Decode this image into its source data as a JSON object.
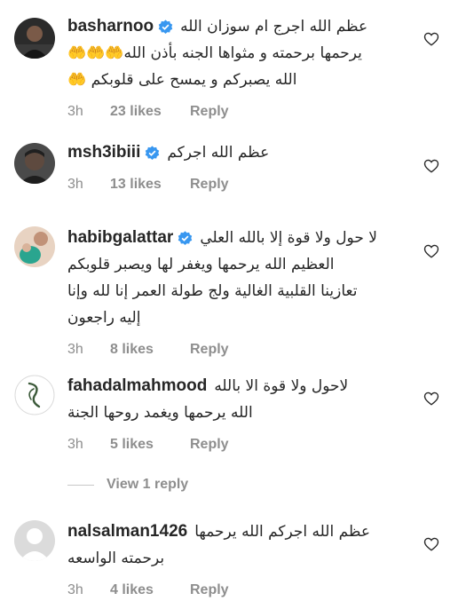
{
  "comments": [
    {
      "username": "basharnoo",
      "verified": true,
      "lines": [
        "عظم الله اجرج ام سوزان الله",
        "يرحمها برحمته و مثواها الجنه بأذن الله🤲🤲🤲",
        "الله يصبركم و يمسح على قلوبكم 🤲"
      ],
      "time": "3h",
      "likes": "23 likes",
      "reply": "Reply"
    },
    {
      "username": "msh3ibiii",
      "verified": true,
      "lines": [
        "عظم الله اجركم"
      ],
      "time": "3h",
      "likes": "13 likes",
      "reply": "Reply"
    },
    {
      "username": "habibgalattar",
      "verified": true,
      "lines": [
        "لا حول ولا قوة إلا بالله العلي",
        "العظيم الله يرحمها ويغفر لها ويصبر قلوبكم",
        "تعازينا القلبية الغالية ولج طولة العمر إنا لله وإنا",
        "إليه راجعون"
      ],
      "time": "3h",
      "likes": "8 likes",
      "reply": "Reply"
    },
    {
      "username": "fahadalmahmood",
      "verified": false,
      "lines": [
        "لاحول ولا قوة الا بالله",
        "الله يرحمها ويغمد روحها الجنة"
      ],
      "time": "3h",
      "likes": "5 likes",
      "reply": "Reply"
    },
    {
      "username": "nalsalman1426",
      "verified": false,
      "lines": [
        "عظم الله اجركم الله يرحمها",
        "برحمته الواسعه"
      ],
      "time": "3h",
      "likes": "4 likes",
      "reply": "Reply"
    }
  ],
  "view_replies": "View 1 reply",
  "colors": {
    "text": "#262626",
    "meta": "#8e8e8e",
    "verified": "#3897f0",
    "divider": "#c7c7c7"
  },
  "icons": {
    "heart": "heart-outline-icon",
    "verified": "verified-badge-icon"
  }
}
